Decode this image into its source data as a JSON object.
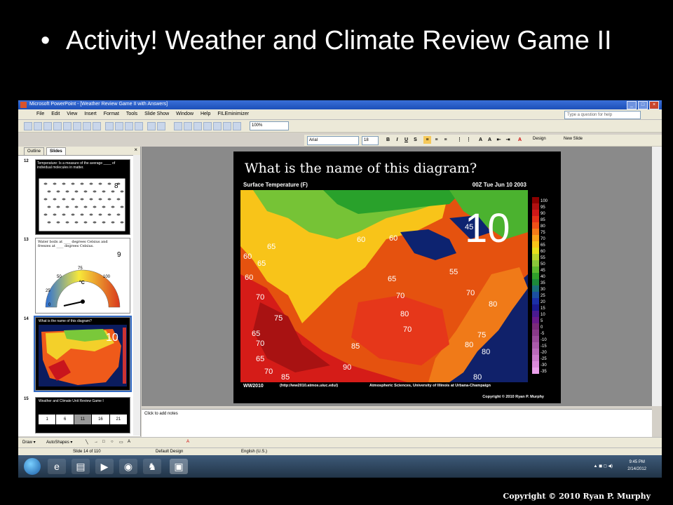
{
  "slide": {
    "bullet": "•",
    "title": "Activity! Weather and Climate Review Game II",
    "copyright": "Copyright © 2010 Ryan P. Murphy"
  },
  "window": {
    "title": "Microsoft PowerPoint - [Weather Review Game II with Answers]",
    "help_placeholder": "Type a question for help"
  },
  "menu": [
    "File",
    "Edit",
    "View",
    "Insert",
    "Format",
    "Tools",
    "Slide Show",
    "Window",
    "Help",
    "FILEminimizer"
  ],
  "toolbar": {
    "zoom": "100%"
  },
  "format": {
    "font": "Arial",
    "size": "18",
    "design": "Design",
    "new_slide": "New Slide"
  },
  "panes": {
    "outline_tab": "Outline",
    "slides_tab": "Slides",
    "close": "×"
  },
  "thumbnails": [
    {
      "num": "12",
      "text": "Temperature: Is a measure of the average ____ of individual molecules in matter.",
      "badge": "8"
    },
    {
      "num": "13",
      "text": "Water boils at ____ degrees Celsius and freezes at ____ degrees Celsius.",
      "badge": "9"
    },
    {
      "num": "14",
      "text": "What is the name of this diagram?",
      "badge": "10"
    },
    {
      "num": "15",
      "text": "Weather and Climate Unit Review Game I",
      "badge": "",
      "cells": [
        "1",
        "6",
        "11",
        "16",
        "21"
      ]
    }
  ],
  "thumb_gauge": {
    "labels": [
      "75",
      "50",
      "25",
      "0",
      "100"
    ],
    "unit": "°C"
  },
  "current_slide": {
    "question": "What is the name of this diagram?",
    "map_title": "Surface Temperature (F)",
    "map_time": "00Z Tue Jun 10 2003",
    "question_number": "10",
    "footer_left": "WW2010",
    "footer_url": "(http://ww2010.atmos.uiuc.edu/)",
    "footer_right": "Atmospheric Sciences, University of Illinois at Urbana-Champaign",
    "copyright": "Copyright © 2010 Ryan P. Murphy",
    "legend": [
      "100",
      "95",
      "90",
      "85",
      "80",
      "75",
      "70",
      "65",
      "60",
      "55",
      "50",
      "45",
      "40",
      "35",
      "30",
      "25",
      "20",
      "15",
      "10",
      "5",
      "0",
      "-5",
      "-10",
      "-15",
      "-20",
      "-25",
      "-30",
      "-35"
    ],
    "contour_labels": [
      "45",
      "60",
      "60",
      "65",
      "60",
      "65",
      "60",
      "55",
      "65",
      "70",
      "70",
      "70",
      "75",
      "80",
      "65",
      "80",
      "70",
      "70",
      "85",
      "65",
      "75",
      "80",
      "80",
      "90",
      "70",
      "85",
      "80"
    ]
  },
  "notes_placeholder": "Click to add notes",
  "drawbar": {
    "draw": "Draw ▾",
    "autoshapes": "AutoShapes ▾"
  },
  "status": {
    "slide": "Slide 14 of 110",
    "design": "Default Design",
    "language": "English (U.S.)"
  },
  "taskbar": {
    "time": "9:45 PM",
    "date": "2/14/2012"
  }
}
